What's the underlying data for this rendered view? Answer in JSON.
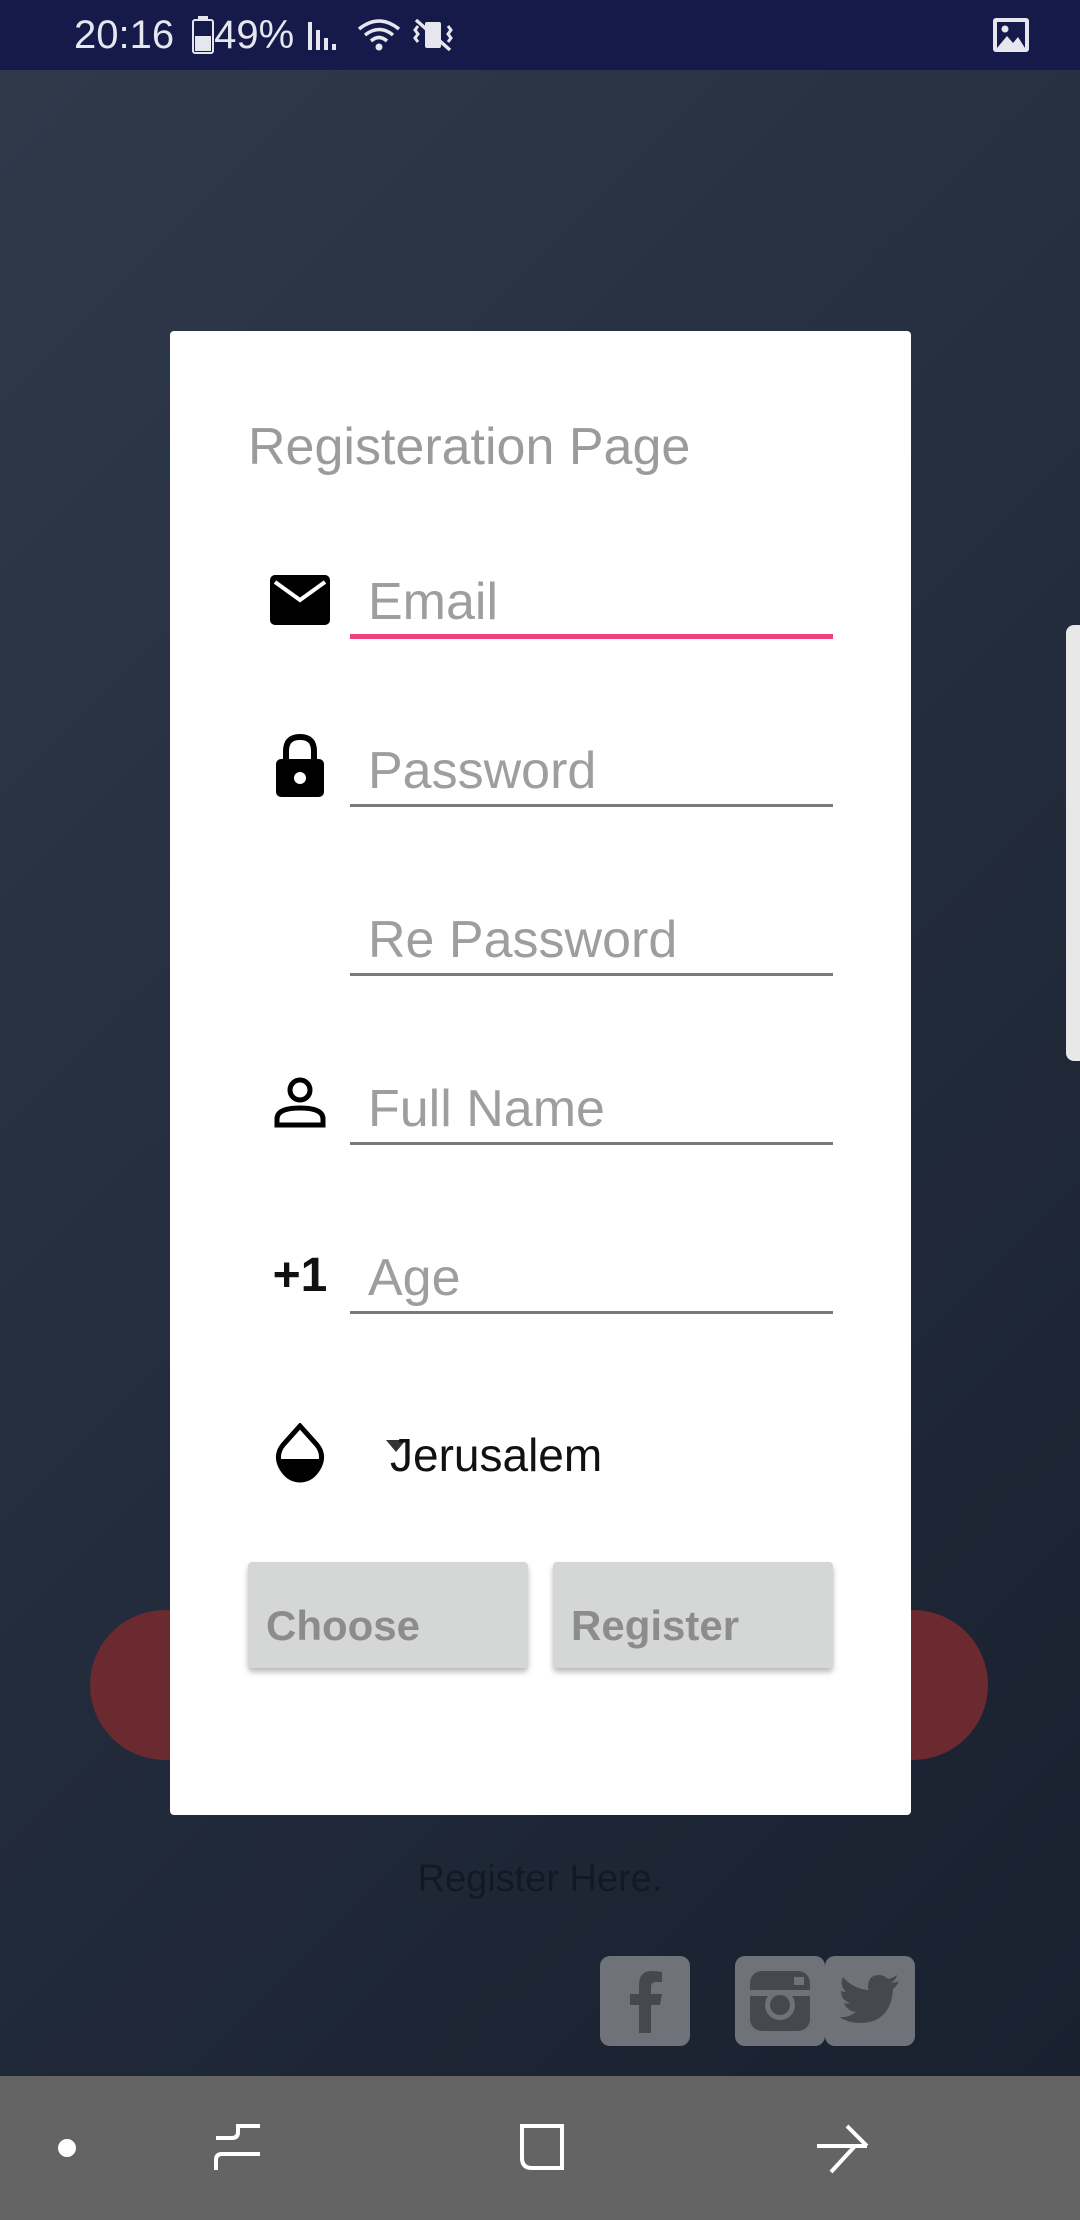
{
  "status_bar": {
    "time": "20:16",
    "battery": "49%",
    "icons": [
      "battery-icon",
      "signal-icon",
      "wifi-icon",
      "vibrate-mute-icon",
      "gallery-notification-icon"
    ]
  },
  "background": {
    "register_link": "Register Here.",
    "social_icons": [
      "facebook-icon",
      "instagram-icon",
      "twitter-icon"
    ]
  },
  "dialog": {
    "title": "Registeration Page",
    "email": {
      "placeholder": "Email",
      "value": "",
      "icon": "mail-icon"
    },
    "password": {
      "placeholder": "Password",
      "value": "",
      "icon": "lock-icon"
    },
    "re_password": {
      "placeholder": "Re Password",
      "value": ""
    },
    "full_name": {
      "placeholder": "Full Name",
      "value": "",
      "icon": "person-icon"
    },
    "age": {
      "placeholder": "Age",
      "value": "",
      "icon_text": "+1"
    },
    "city": {
      "selected": "Jerusalem",
      "icon": "water-drop-icon"
    },
    "buttons": {
      "choose": "Choose",
      "register": "Register"
    }
  },
  "colors": {
    "accent_underline": "#f0407e",
    "status_bar": "#161a4a",
    "button_bg": "#d5d6d6",
    "nav_bar": "#646464"
  },
  "nav_bar": [
    "recent-dot-icon",
    "recents-icon",
    "home-icon",
    "back-icon"
  ]
}
